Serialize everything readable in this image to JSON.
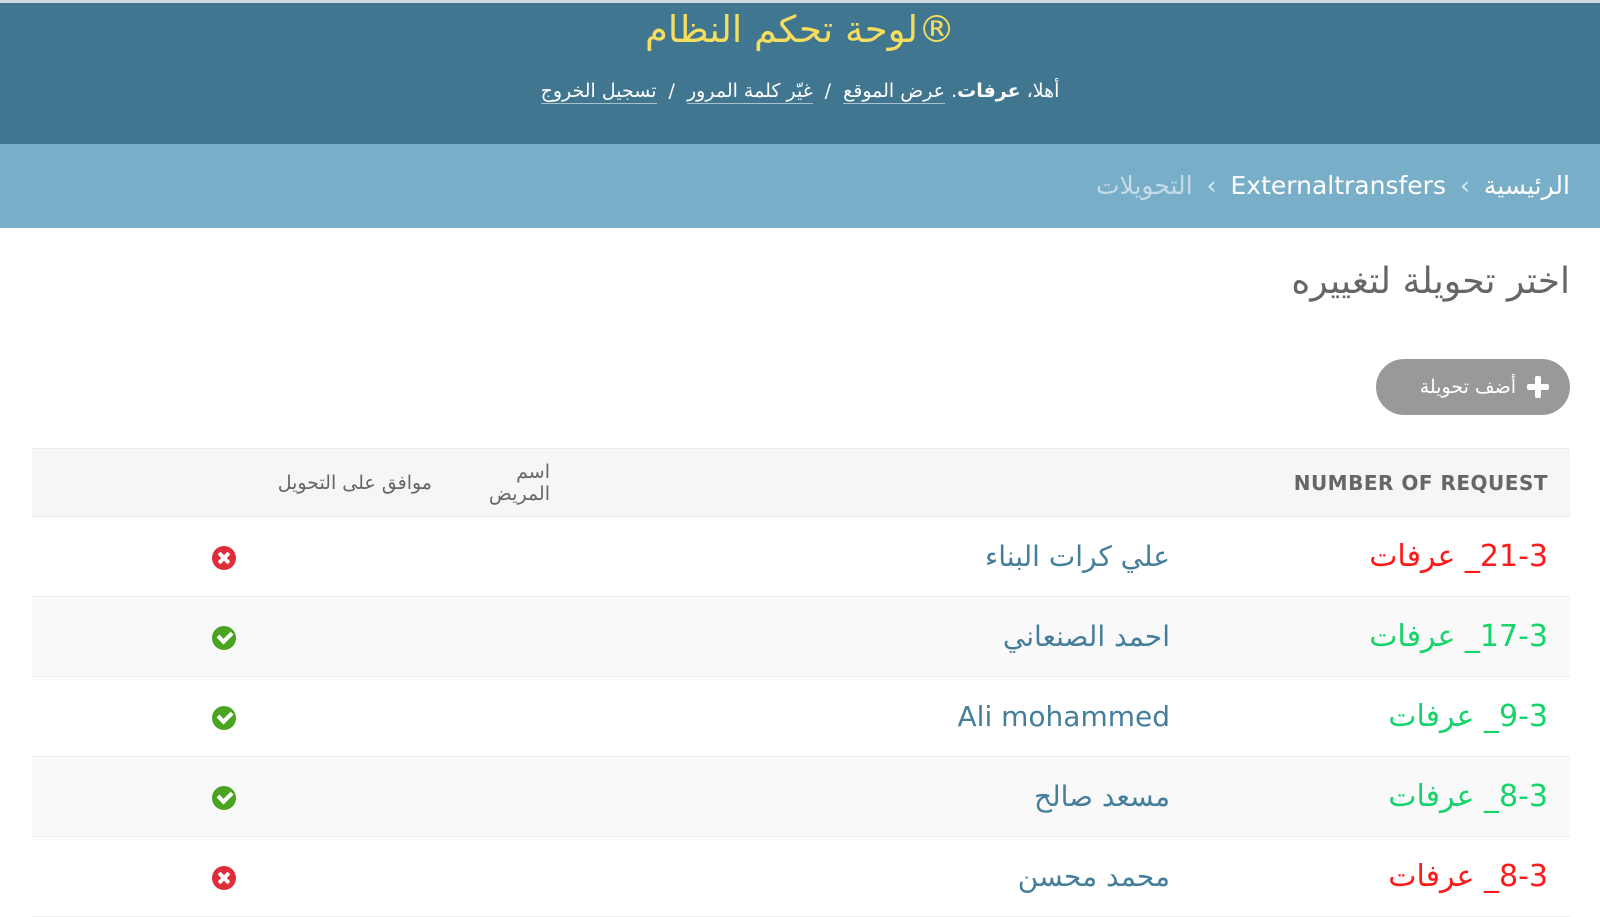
{
  "header": {
    "site_title": "لوحة تحكم النظام®",
    "welcome_prefix": "أهلا، ",
    "username": "عرفات",
    "welcome_suffix": ".",
    "view_site": "عرض الموقع",
    "change_password": "غيّر كلمة المرور",
    "logout": "تسجيل الخروج",
    "separator": "/"
  },
  "breadcrumbs": {
    "home": "الرئيسية",
    "app": "Externaltransfers",
    "current": "التحويلات",
    "separator": "›"
  },
  "page": {
    "title": "اختر تحويلة لتغييره",
    "add_button_label": "أضف تحويلة"
  },
  "table": {
    "columns": {
      "number": "NUMBER OF REQUEST",
      "patient": "اسم المريض",
      "approved": "موافق على التحويل"
    },
    "rows": [
      {
        "number": "21-3_ عرفات",
        "patient": "علي كرات البناء",
        "approved": false,
        "number_color": "#ff1a1a",
        "status_icon": "x-circle-icon"
      },
      {
        "number": "17-3_ عرفات",
        "patient": "احمد الصنعاني",
        "approved": true,
        "number_color": "#16d36a",
        "status_icon": "check-circle-icon"
      },
      {
        "number": "9-3_ عرفات",
        "patient": "Ali mohammed",
        "approved": true,
        "number_color": "#16d36a",
        "status_icon": "check-circle-icon"
      },
      {
        "number": "8-3_ عرفات",
        "patient": "مسعد صالح",
        "approved": true,
        "number_color": "#16d36a",
        "status_icon": "check-circle-icon"
      },
      {
        "number": "8-3_ عرفات",
        "patient": "محمد محسن",
        "approved": false,
        "number_color": "#ff1a1a",
        "status_icon": "x-circle-icon"
      }
    ]
  },
  "colors": {
    "header_bg": "#417690",
    "breadcrumb_bg": "#79aec8",
    "site_title": "#f5dd5d",
    "add_button_bg": "#999999"
  }
}
